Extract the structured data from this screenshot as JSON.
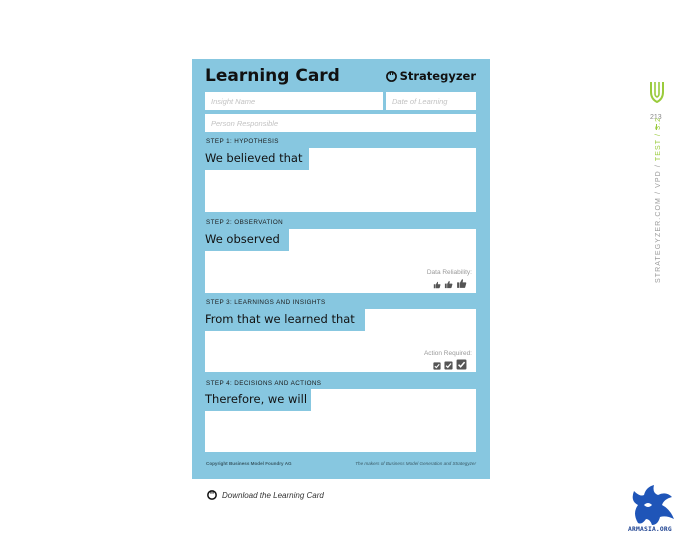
{
  "card": {
    "title": "Learning Card",
    "brand": "Strategyzer",
    "fields": {
      "insight_name": "Insight Name",
      "date_of_learning": "Date of Learning",
      "person_responsible": "Person Responsible"
    },
    "steps": [
      {
        "label": "STEP 1: HYPOTHESIS",
        "heading": "We believed that"
      },
      {
        "label": "STEP 2: OBSERVATION",
        "heading": "We observed",
        "rating_label": "Data Reliability:",
        "rating_icons": [
          "thumbs-up-small-icon",
          "thumbs-up-medium-icon",
          "thumbs-up-large-icon"
        ]
      },
      {
        "label": "STEP 3: LEARNINGS AND INSIGHTS",
        "heading": "From that we learned that",
        "rating_label": "Action Required:",
        "rating_icons": [
          "checkbox-small-icon",
          "checkbox-medium-icon",
          "checkbox-large-icon"
        ]
      },
      {
        "label": "STEP 4: DECISIONS AND ACTIONS",
        "heading": "Therefore, we will"
      }
    ],
    "footer_left": "Copyright Business Model Foundry AG",
    "footer_right": "The makers of Business Model Generation and Strategyzer"
  },
  "download": {
    "label": "Download the Learning Card"
  },
  "sidebar": {
    "page_number": "213",
    "path_text": "STRATEGYZER.COM / VPD / ",
    "path_highlight": "TEST / 3.2"
  },
  "watermark": {
    "text": "ARMASIA.ORG"
  },
  "colors": {
    "card_bg": "#87c7e0",
    "accent_green": "#9acb3c",
    "logo_blue": "#1a3f8f"
  }
}
